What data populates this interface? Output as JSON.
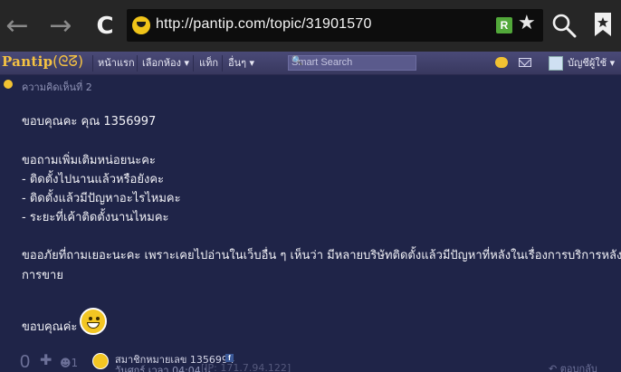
{
  "browser": {
    "back_glyph": "←",
    "forward_glyph": "→",
    "reload_glyph": "C",
    "url": "http://pantip.com/topic/31901570",
    "extension_label": "R",
    "star_glyph": "★"
  },
  "toolbar": {
    "logo_text": "Pantip",
    "logo_swirl": "(ᘓᘔ)",
    "nav_items": [
      "หน้าแรก",
      "เลือกห้อง ▾",
      "แท็ก",
      "อื่นๆ ▾"
    ],
    "search_placeholder": "Smart Search",
    "search_glyph": "🔍",
    "account_label": "บัญชีผู้ใช้ ▾"
  },
  "comment": {
    "header_label": "ความคิดเห็นที่ 2",
    "lines": [
      "ขอบคุณคะ คุณ 1356997",
      "ขอถามเพิ่มเติมหน่อยนะคะ",
      "- ติดตั้งไปนานแล้วหรือยังคะ",
      "- ติดตั้งแล้วมีปัญหาอะไรไหมคะ",
      "- ระยะที่เค้าติดตั้งนานไหมคะ",
      "ขออภัยที่ถามเยอะนะคะ เพราะเคยไปอ่านในเว็บอื่น ๆ เห็นว่า มีหลายบริษัทติดตั้งแล้วมีปัญหาที่หลังในเรื่องการบริการหลัง",
      "การขาย",
      "ขอบคุณค่ะ"
    ]
  },
  "footer": {
    "vote_count": "0",
    "plus_glyph": "✚",
    "emotion_count": "☻1",
    "member_name": "สมาชิกหมายเลข 1356994",
    "facebook_glyph": "f",
    "post_time": "วันศุกร์ เวลา 04:04 น.",
    "post_ip": "[IP: 171.7.94.122]",
    "reply_label": "↶ ตอบกลับ"
  }
}
